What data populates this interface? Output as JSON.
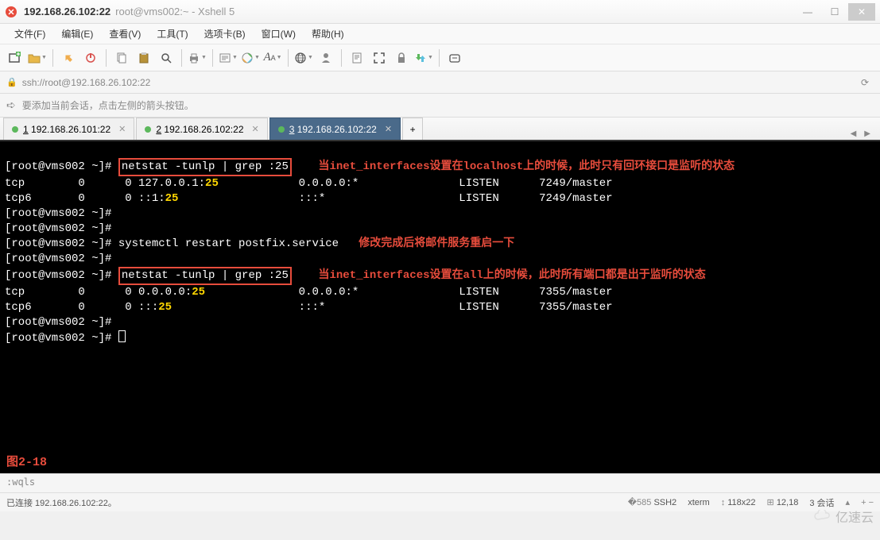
{
  "window": {
    "title": "192.168.26.102:22",
    "subtitle": "root@vms002:~ - Xshell 5"
  },
  "menu": {
    "file": "文件(F)",
    "edit": "编辑(E)",
    "view": "查看(V)",
    "tools": "工具(T)",
    "tab": "选项卡(B)",
    "window": "窗口(W)",
    "help": "帮助(H)"
  },
  "address": {
    "url": "ssh://root@192.168.26.102:22"
  },
  "hint": {
    "text": "要添加当前会话，点击左侧的箭头按钮。"
  },
  "tabs": [
    {
      "num": "1",
      "label": "192.168.26.101:22",
      "active": false
    },
    {
      "num": "2",
      "label": "192.168.26.102:22",
      "active": false
    },
    {
      "num": "3",
      "label": "192.168.26.102:22",
      "active": true
    }
  ],
  "terminal": {
    "prompt": "[root@vms002 ~]#",
    "cmd1": "netstat -tunlp | grep :25",
    "note1": "当inet_interfaces设置在localhost上的时候，此时只有回环接口是监听的状态",
    "line1a": "tcp        0      0 127.0.0.1:",
    "line1a_port": "25",
    "line1a_rest": "            0.0.0.0:*               LISTEN      7249/master",
    "line1b": "tcp6       0      0 ::1:",
    "line1b_port": "25",
    "line1b_rest": "                  :::*                    LISTEN      7249/master",
    "cmd2": "systemctl restart postfix.service",
    "note2": "修改完成后将邮件服务重启一下",
    "cmd3": "netstat -tunlp | grep :25",
    "note3": "当inet_interfaces设置在all上的时候，此时所有端口都是出于监听的状态",
    "line3a": "tcp        0      0 0.0.0.0:",
    "line3a_port": "25",
    "line3a_rest": "              0.0.0.0:*               LISTEN      7355/master",
    "line3b": "tcp6       0      0 :::",
    "line3b_port": "25",
    "line3b_rest": "                   :::*                    LISTEN      7355/master",
    "figure": "图2-18"
  },
  "cmdline": ":wqls",
  "status": {
    "conn": "已连接 192.168.26.102:22。",
    "ssh": "SSH2",
    "term": "xterm",
    "size": "118x22",
    "pos": "12,18",
    "session": "3 会话"
  },
  "watermark": "亿速云"
}
